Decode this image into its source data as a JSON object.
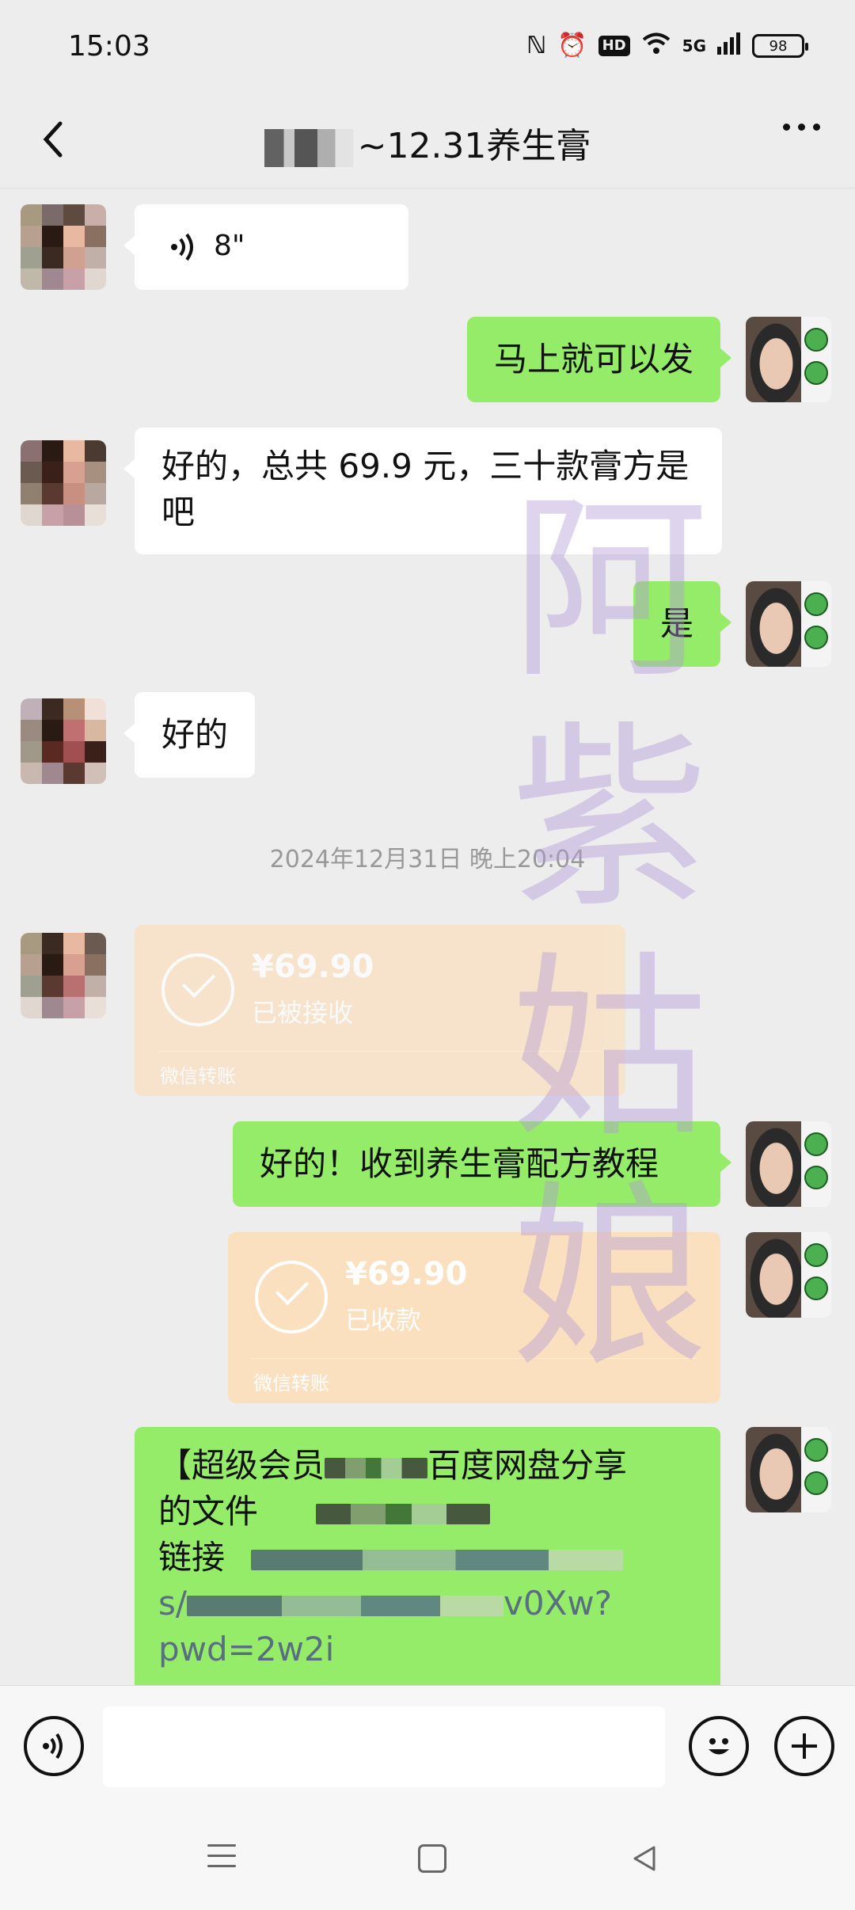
{
  "status_bar": {
    "time": "15:03",
    "network": "5G",
    "hd_label": "HD",
    "battery": "98"
  },
  "header": {
    "title_visible": "~12.31养生膏"
  },
  "messages": {
    "voice_duration": "8\"",
    "sent_1": "马上就可以发",
    "recv_1": "好的，总共 69.9 元，三十款膏方是吧",
    "sent_2": "是",
    "recv_2": "好的",
    "timestamp": "2024年12月31日 晚上20:04",
    "sent_3": "好的！收到养生膏配方教程"
  },
  "transfers": {
    "incoming": {
      "amount": "¥69.90",
      "status": "已被接收",
      "label": "微信转账"
    },
    "outgoing": {
      "amount": "¥69.90",
      "status": "已收款",
      "label": "微信转账"
    }
  },
  "share_message": {
    "line1_start": "【超级会员",
    "line1_end": "百度网盘分享",
    "line2": "的文件",
    "line3": "链接",
    "line4_start": "s/",
    "line4_end": "v0Xw?",
    "line5": "pwd=2w2i"
  },
  "watermark": "阿紫姑娘",
  "colors": {
    "sent_bubble": "#95ec69",
    "received_bubble": "#ffffff",
    "transfer_card": "#fbe0bf",
    "background": "#ededed"
  },
  "icons": [
    "back-icon",
    "more-icon",
    "voice-icon",
    "emoji-icon",
    "plus-icon",
    "checkmark-icon"
  ]
}
